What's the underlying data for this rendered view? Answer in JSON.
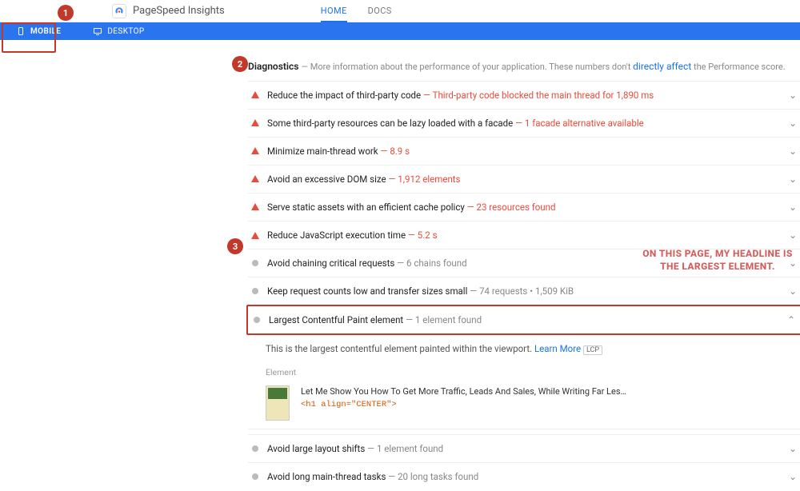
{
  "header": {
    "app_name": "PageSpeed Insights",
    "nav": {
      "home": "HOME",
      "docs": "DOCS"
    }
  },
  "bluebar": {
    "mobile": "MOBILE",
    "desktop": "DESKTOP"
  },
  "annotations": {
    "n1": "1",
    "n2": "2",
    "n3": "3",
    "side_note": "ON THIS PAGE, MY HEADLINE IS THE LARGEST ELEMENT."
  },
  "diagnostics": {
    "title": "Diagnostics",
    "subtitle_prefix": " — More information about the performance of your application. These numbers don't ",
    "subtitle_link": "directly affect",
    "subtitle_suffix": " the Performance score.",
    "rows": [
      {
        "icon": "tri",
        "title": "Reduce the impact of third-party code",
        "metric": "Third-party code blocked the main thread for 1,890 ms",
        "metric_class": "metric"
      },
      {
        "icon": "tri",
        "title": "Some third-party resources can be lazy loaded with a facade",
        "metric": "1 facade alternative available",
        "metric_class": "metric"
      },
      {
        "icon": "tri",
        "title": "Minimize main-thread work",
        "metric": "8.9 s",
        "metric_class": "metric"
      },
      {
        "icon": "tri",
        "title": "Avoid an excessive DOM size",
        "metric": "1,912 elements",
        "metric_class": "metric"
      },
      {
        "icon": "tri",
        "title": "Serve static assets with an efficient cache policy",
        "metric": "23 resources found",
        "metric_class": "metric"
      },
      {
        "icon": "tri",
        "title": "Reduce JavaScript execution time",
        "metric": "5.2 s",
        "metric_class": "metric"
      },
      {
        "icon": "dot",
        "title": "Avoid chaining critical requests",
        "metric": "6 chains found",
        "metric_class": "metric-gray"
      },
      {
        "icon": "dot",
        "title": "Keep request counts low and transfer sizes small",
        "metric": "74 requests • 1,509 KiB",
        "metric_class": "metric-gray"
      }
    ],
    "lcp_row": {
      "title": "Largest Contentful Paint element",
      "metric": "1 element found",
      "desc_prefix": "This is the largest contentful element painted within the viewport. ",
      "learn_more": "Learn More",
      "tag": "LCP",
      "element_label": "Element",
      "element_text": "Let Me Show You How To Get More Traffic, Leads And Sales, While Writing Far Les…",
      "element_code": "<h1 align=\"CENTER\">"
    },
    "tail_rows": [
      {
        "icon": "dot",
        "title": "Avoid large layout shifts",
        "metric": "1 element found",
        "metric_class": "metric-gray"
      },
      {
        "icon": "dot",
        "title": "Avoid long main-thread tasks",
        "metric": "20 long tasks found",
        "metric_class": "metric-gray"
      }
    ]
  }
}
